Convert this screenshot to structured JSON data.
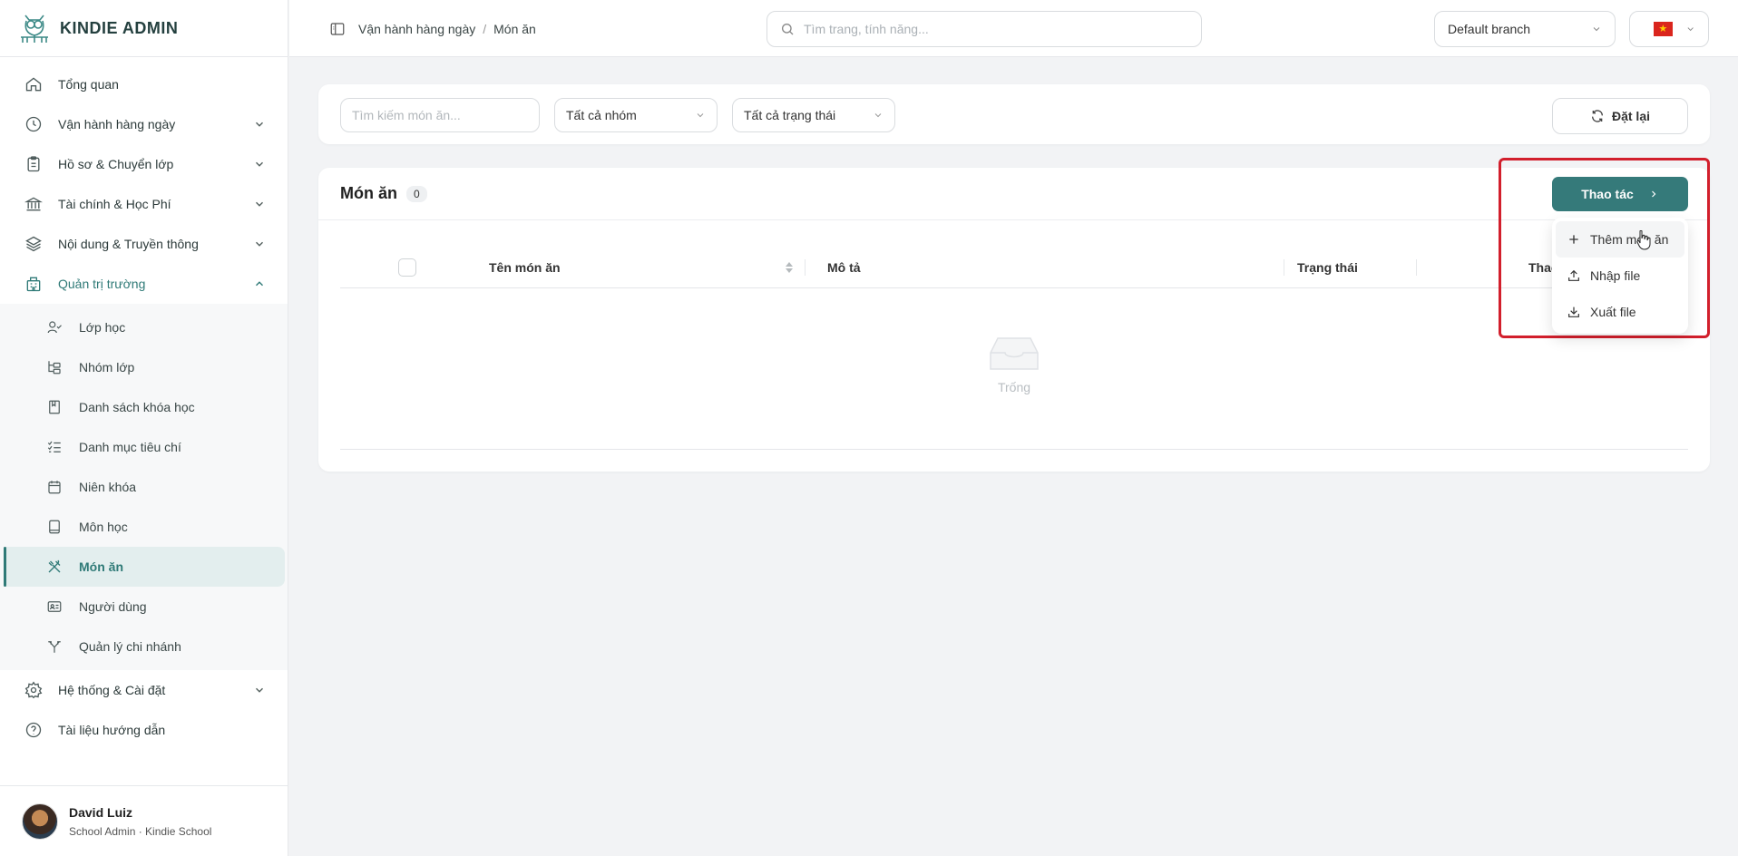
{
  "app": {
    "brand": "KINDIE ADMIN"
  },
  "sidebar": {
    "items": [
      {
        "label": "Tổng quan",
        "icon": "home-icon"
      },
      {
        "label": "Vận hành hàng ngày",
        "icon": "clock-icon"
      },
      {
        "label": "Hồ sơ & Chuyển lớp",
        "icon": "clipboard-icon"
      },
      {
        "label": "Tài chính & Học Phí",
        "icon": "bank-icon"
      },
      {
        "label": "Nội dung & Truyền thông",
        "icon": "layers-icon"
      },
      {
        "label": "Quản trị trường",
        "icon": "building-icon"
      }
    ],
    "sub_items": [
      {
        "label": "Lớp học",
        "icon": "user-check-icon"
      },
      {
        "label": "Nhóm lớp",
        "icon": "tree-icon"
      },
      {
        "label": "Danh sách khóa học",
        "icon": "book-bookmark-icon"
      },
      {
        "label": "Danh mục tiêu chí",
        "icon": "checklist-icon"
      },
      {
        "label": "Niên khóa",
        "icon": "calendar-icon"
      },
      {
        "label": "Môn học",
        "icon": "book-icon"
      },
      {
        "label": "Món ăn",
        "icon": "utensils-crossed-icon"
      },
      {
        "label": "Người dùng",
        "icon": "id-card-icon"
      },
      {
        "label": "Quản lý chi nhánh",
        "icon": "split-icon"
      }
    ],
    "bottom_items": [
      {
        "label": "Hệ thống & Cài đặt",
        "icon": "gear-icon"
      },
      {
        "label": "Tài liệu hướng dẫn",
        "icon": "help-circle-icon"
      }
    ]
  },
  "user": {
    "name": "David Luiz",
    "role": "School Admin · Kindie School"
  },
  "topbar": {
    "breadcrumb": [
      "Vận hành hàng ngày",
      "Món ăn"
    ],
    "breadcrumb_sep": "/",
    "search_placeholder": "Tìm trang, tính năng...",
    "branch": "Default branch",
    "flag_star": "★"
  },
  "filters": {
    "search_placeholder": "Tìm kiếm món ăn...",
    "group": "Tất cả nhóm",
    "status": "Tất cả trạng thái",
    "reset": "Đặt lại"
  },
  "table": {
    "title": "Món ăn",
    "count": "0",
    "columns": [
      "Tên món ăn",
      "Mô tả",
      "Trạng thái",
      "Thao"
    ],
    "empty_text": "Trống"
  },
  "actions": {
    "button": "Thao tác",
    "menu": [
      "Thêm món ăn",
      "Nhập file",
      "Xuất file"
    ]
  },
  "colors": {
    "accent": "#357a7a",
    "highlight": "#d21f2c"
  }
}
